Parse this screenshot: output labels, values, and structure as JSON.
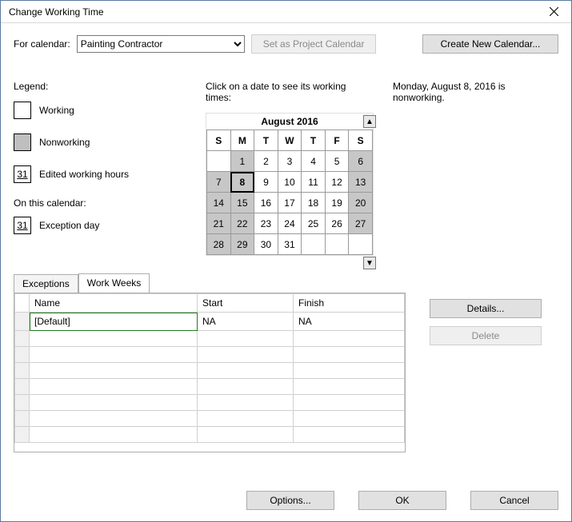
{
  "title": "Change Working Time",
  "for_calendar_label": "For calendar:",
  "calendar_selected": "Painting Contractor",
  "btn_set_project": "Set as Project Calendar",
  "btn_create_new": "Create New Calendar...",
  "legend": {
    "heading": "Legend:",
    "working": "Working",
    "nonworking": "Nonworking",
    "edited": "Edited working hours",
    "edited_num": "31",
    "on_this": "On this calendar:",
    "exception": "Exception day",
    "exception_num": "31"
  },
  "calendar": {
    "prompt": "Click on a date to see its working times:",
    "month_label": "August 2016",
    "day_headers": [
      "S",
      "M",
      "T",
      "W",
      "T",
      "F",
      "S"
    ],
    "weeks": [
      [
        {
          "n": "",
          "nw": false
        },
        {
          "n": "1",
          "nw": true
        },
        {
          "n": "2",
          "nw": false
        },
        {
          "n": "3",
          "nw": false
        },
        {
          "n": "4",
          "nw": false
        },
        {
          "n": "5",
          "nw": false
        },
        {
          "n": "6",
          "nw": true
        }
      ],
      [
        {
          "n": "7",
          "nw": true
        },
        {
          "n": "8",
          "nw": true,
          "sel": true
        },
        {
          "n": "9",
          "nw": false
        },
        {
          "n": "10",
          "nw": false
        },
        {
          "n": "11",
          "nw": false
        },
        {
          "n": "12",
          "nw": false
        },
        {
          "n": "13",
          "nw": true
        }
      ],
      [
        {
          "n": "14",
          "nw": true
        },
        {
          "n": "15",
          "nw": true
        },
        {
          "n": "16",
          "nw": false
        },
        {
          "n": "17",
          "nw": false
        },
        {
          "n": "18",
          "nw": false
        },
        {
          "n": "19",
          "nw": false
        },
        {
          "n": "20",
          "nw": true
        }
      ],
      [
        {
          "n": "21",
          "nw": true
        },
        {
          "n": "22",
          "nw": true
        },
        {
          "n": "23",
          "nw": false
        },
        {
          "n": "24",
          "nw": false
        },
        {
          "n": "25",
          "nw": false
        },
        {
          "n": "26",
          "nw": false
        },
        {
          "n": "27",
          "nw": true
        }
      ],
      [
        {
          "n": "28",
          "nw": true
        },
        {
          "n": "29",
          "nw": true
        },
        {
          "n": "30",
          "nw": false
        },
        {
          "n": "31",
          "nw": false
        },
        {
          "n": "",
          "nw": false
        },
        {
          "n": "",
          "nw": false
        },
        {
          "n": "",
          "nw": false
        }
      ]
    ]
  },
  "info_text": "Monday, August 8, 2016 is nonworking.",
  "tabs": {
    "exceptions": "Exceptions",
    "workweeks": "Work Weeks"
  },
  "grid": {
    "headers": {
      "name": "Name",
      "start": "Start",
      "finish": "Finish"
    },
    "rows": [
      {
        "name": "[Default]",
        "start": "NA",
        "finish": "NA"
      }
    ]
  },
  "btn_details": "Details...",
  "btn_delete": "Delete",
  "btn_options": "Options...",
  "btn_ok": "OK",
  "btn_cancel": "Cancel"
}
